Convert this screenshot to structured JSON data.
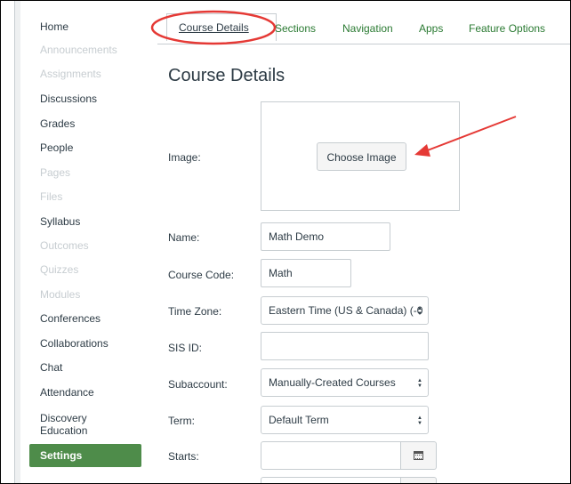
{
  "sidebar": {
    "items": [
      {
        "label": "Home",
        "disabled": false
      },
      {
        "label": "Announcements",
        "disabled": true
      },
      {
        "label": "Assignments",
        "disabled": true
      },
      {
        "label": "Discussions",
        "disabled": false
      },
      {
        "label": "Grades",
        "disabled": false
      },
      {
        "label": "People",
        "disabled": false
      },
      {
        "label": "Pages",
        "disabled": true
      },
      {
        "label": "Files",
        "disabled": true
      },
      {
        "label": "Syllabus",
        "disabled": false
      },
      {
        "label": "Outcomes",
        "disabled": true
      },
      {
        "label": "Quizzes",
        "disabled": true
      },
      {
        "label": "Modules",
        "disabled": true
      },
      {
        "label": "Conferences",
        "disabled": false
      },
      {
        "label": "Collaborations",
        "disabled": false
      },
      {
        "label": "Chat",
        "disabled": false
      },
      {
        "label": "Attendance",
        "disabled": false
      },
      {
        "label": "Discovery\nEducation",
        "disabled": false
      },
      {
        "label": "Settings",
        "disabled": false,
        "active": true
      }
    ]
  },
  "tabs": [
    "Course Details",
    "Sections",
    "Navigation",
    "Apps",
    "Feature Options"
  ],
  "page": {
    "title": "Course Details"
  },
  "form": {
    "image_label": "Image:",
    "choose_image": "Choose Image",
    "name_label": "Name:",
    "name_value": "Math Demo",
    "code_label": "Course Code:",
    "code_value": "Math",
    "timezone_label": "Time Zone:",
    "timezone_value": "Eastern Time (US & Canada) (-0",
    "sis_label": "SIS ID:",
    "sis_value": "",
    "subaccount_label": "Subaccount:",
    "subaccount_value": "Manually-Created Courses",
    "term_label": "Term:",
    "term_value": "Default Term",
    "starts_label": "Starts:",
    "starts_value": ""
  },
  "colors": {
    "accent_green": "#4e8c4a",
    "tab_green": "#2a7a32",
    "annotation_red": "#e53935"
  },
  "icons": [
    "calendar-icon",
    "select-arrows-icon"
  ]
}
